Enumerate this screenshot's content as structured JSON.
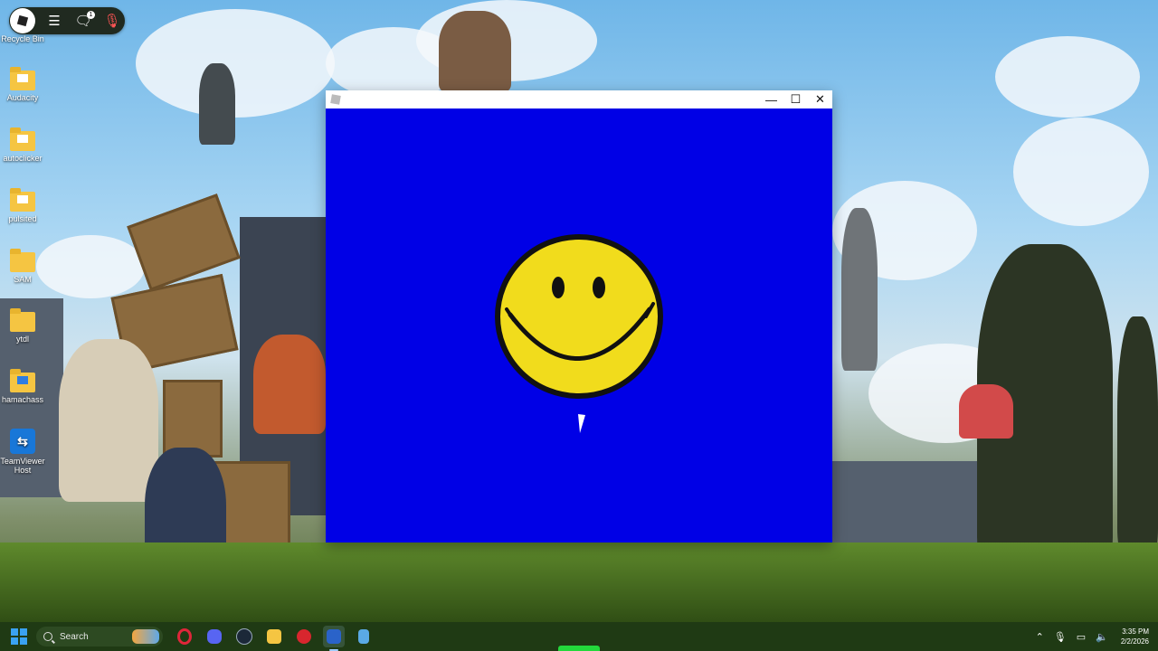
{
  "game_bar": {
    "notification_count": "1"
  },
  "desktop": {
    "icons": [
      {
        "label": "Recycle Bin",
        "icon": "recycle-bin-icon"
      },
      {
        "label": "Audacity",
        "icon": "folder-icon"
      },
      {
        "label": "autoclicker",
        "icon": "folder-icon"
      },
      {
        "label": "pulsited",
        "icon": "folder-icon"
      },
      {
        "label": "SAM",
        "icon": "folder-icon"
      },
      {
        "label": "ytdl",
        "icon": "folder-icon"
      },
      {
        "label": "hamachass",
        "icon": "folder-icon"
      },
      {
        "label": "TeamViewer Host",
        "icon": "teamviewer-icon"
      }
    ]
  },
  "window": {
    "content_bg": "#0000e6",
    "smiley_color": "#f1dc1c",
    "minimize_glyph": "—",
    "maximize_glyph": "☐",
    "close_glyph": "✕"
  },
  "taskbar": {
    "search_placeholder": "Search",
    "apps": [
      "opera-icon",
      "discord-icon",
      "steam-icon",
      "file-explorer-icon",
      "roblox-icon",
      "app-window-icon",
      "notepad-icon"
    ],
    "clock_time": "3:35 PM",
    "clock_date": "2/2/2026",
    "tray_icons": [
      "chevron-up-icon",
      "microphone-icon",
      "network-icon",
      "speaker-icon"
    ]
  }
}
